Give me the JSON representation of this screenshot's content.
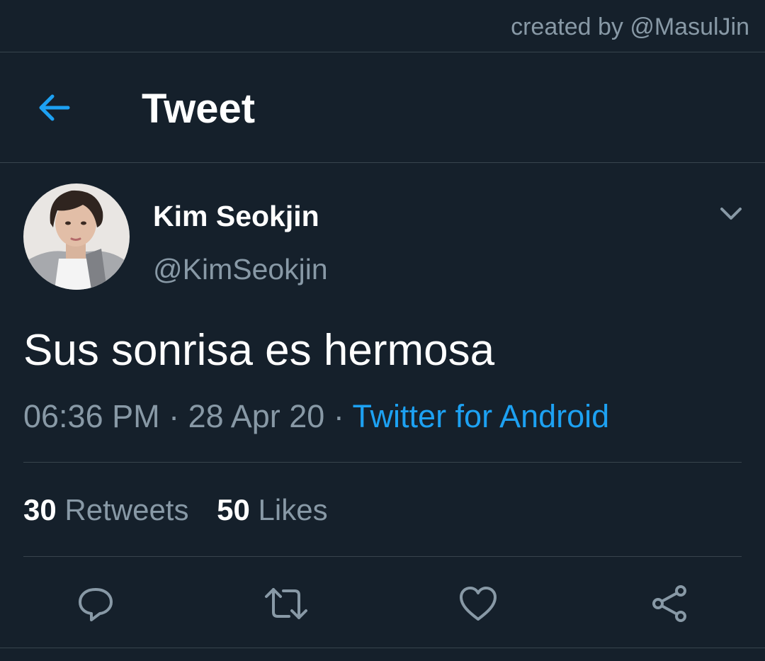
{
  "credit": "created by @MasulJin",
  "header": {
    "title": "Tweet",
    "back_icon": "arrow-left-icon"
  },
  "tweet": {
    "display_name": "Kim Seokjin",
    "handle": "@KimSeokjin",
    "text": "Sus sonrisa es hermosa",
    "time": "06:36 PM",
    "date": "28 Apr 20",
    "separator": "·",
    "source": "Twitter for Android"
  },
  "stats": {
    "retweets_count": "30",
    "retweets_label": "Retweets",
    "likes_count": "50",
    "likes_label": "Likes"
  },
  "actions": [
    "reply-icon",
    "retweet-icon",
    "like-icon",
    "share-icon"
  ],
  "colors": {
    "background": "#15202b",
    "accent": "#1da1f2",
    "muted_text": "#8899a6",
    "divider": "#38444d"
  }
}
